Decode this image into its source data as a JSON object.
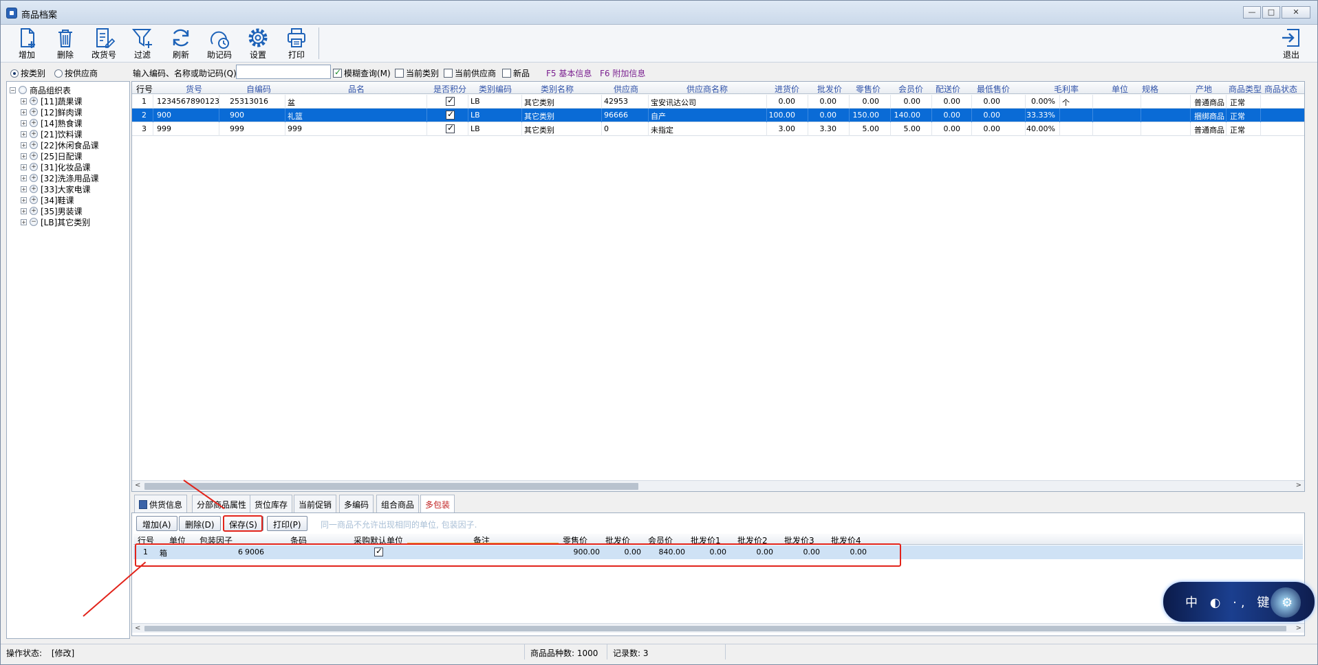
{
  "window": {
    "title": "商品档案",
    "controls": [
      "—",
      "□",
      "✕"
    ]
  },
  "toolbar": {
    "buttons": [
      {
        "label": "增加",
        "icon": "add-document-icon"
      },
      {
        "label": "删除",
        "icon": "trash-icon"
      },
      {
        "label": "改货号",
        "icon": "edit-document-icon"
      },
      {
        "label": "过滤",
        "icon": "filter-icon"
      },
      {
        "label": "刷新",
        "icon": "refresh-icon"
      },
      {
        "label": "助记码",
        "icon": "memo-code-icon"
      },
      {
        "label": "设置",
        "icon": "gear-icon"
      },
      {
        "label": "打印",
        "icon": "printer-icon"
      }
    ],
    "exit_label": "退出"
  },
  "filter": {
    "radio_category": "按类别",
    "radio_supplier": "按供应商",
    "search_label": "输入编码、名称或助记码(Q)",
    "search_value": "",
    "fuzzy_label": "模糊查询(M)",
    "current_category_label": "当前类别",
    "current_supplier_label": "当前供应商",
    "new_label": "新品",
    "f5_label": "F5 基本信息",
    "f6_label": "F6 附加信息"
  },
  "tree": {
    "root": "商品组织表",
    "items": [
      "[11]蔬果课",
      "[12]鲜肉课",
      "[14]熟食课",
      "[21]饮料课",
      "[22]休闲食品课",
      "[25]日配课",
      "[31]化妆品课",
      "[32]洗涤用品课",
      "[33]大家电课",
      "[34]鞋课",
      "[35]男装课",
      "[LB]其它类别"
    ]
  },
  "grid": {
    "headers": [
      "行号",
      "货号",
      "自编码",
      "品名",
      "是否积分",
      "类别编码",
      "类别名称",
      "供应商",
      "供应商名称",
      "进货价",
      "批发价",
      "零售价",
      "会员价",
      "配送价",
      "最低售价",
      "毛利率",
      "单位",
      "规格",
      "产地",
      "商品类型",
      "商品状态"
    ],
    "rows": [
      {
        "no": "1",
        "sku": "1234567890123",
        "code": "25313016",
        "name": "盆",
        "cat_code": "LB",
        "cat_name": "其它类别",
        "supplier": "42953",
        "supplier_name": "宝安讯达公司",
        "cost": "0.00",
        "wholesale": "0.00",
        "retail": "0.00",
        "member": "0.00",
        "delivery": "0.00",
        "min_price": "0.00",
        "margin": "0.00%",
        "unit": "个",
        "spec": "",
        "origin": "",
        "type": "普通商品",
        "status": "正常"
      },
      {
        "no": "2",
        "sku": "900",
        "code": "900",
        "name": "礼篮",
        "cat_code": "LB",
        "cat_name": "其它类别",
        "supplier": "96666",
        "supplier_name": "自产",
        "cost": "100.00",
        "wholesale": "0.00",
        "retail": "150.00",
        "member": "140.00",
        "delivery": "0.00",
        "min_price": "0.00",
        "margin": "33.33%",
        "unit": "",
        "spec": "",
        "origin": "",
        "type": "捆绑商品",
        "status": "正常"
      },
      {
        "no": "3",
        "sku": "999",
        "code": "999",
        "name": "999",
        "cat_code": "LB",
        "cat_name": "其它类别",
        "supplier": "0",
        "supplier_name": "未指定",
        "cost": "3.00",
        "wholesale": "3.30",
        "retail": "5.00",
        "member": "5.00",
        "delivery": "0.00",
        "min_price": "0.00",
        "margin": "40.00%",
        "unit": "",
        "spec": "",
        "origin": "",
        "type": "普通商品",
        "status": "正常"
      }
    ]
  },
  "tabs": [
    "供货信息",
    "分部商品属性",
    "货位库存",
    "当前促销",
    "多编码",
    "组合商品",
    "多包装"
  ],
  "sub": {
    "buttons": {
      "add": "增加(A)",
      "delete": "删除(D)",
      "save": "保存(S)",
      "print": "打印(P)"
    },
    "hint": "同一商品不允许出现相同的单位, 包装因子.",
    "headers": [
      "行号",
      "单位",
      "包装因子",
      "条码",
      "采购默认单位",
      "备注",
      "零售价",
      "批发价",
      "会员价",
      "批发价1",
      "批发价2",
      "批发价3",
      "批发价4"
    ],
    "row": {
      "no": "1",
      "unit": "箱",
      "factor": "6",
      "barcode": "9006",
      "note": "",
      "retail": "900.00",
      "wholesale": "0.00",
      "member": "840.00",
      "w1": "0.00",
      "w2": "0.00",
      "w3": "0.00",
      "w4": "0.00"
    }
  },
  "status": {
    "op_label": "操作状态:",
    "op_value": "[修改]",
    "kinds": "商品品种数: 1000",
    "records": "记录数: 3"
  },
  "widget": {
    "text": "中 ◐ ·, 键 ⚙"
  }
}
